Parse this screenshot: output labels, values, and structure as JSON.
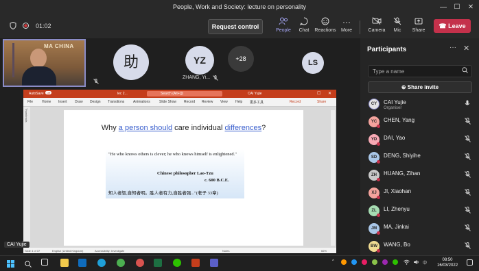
{
  "window": {
    "title": "People, Work and Society: lecture on personality",
    "controls": {
      "minimize": "—",
      "maximize": "☐",
      "close": "✕"
    }
  },
  "toolbar": {
    "timer": "01:02",
    "request_control": "Request control",
    "tools": [
      {
        "label": "People",
        "icon": "people-icon"
      },
      {
        "label": "Chat",
        "icon": "chat-icon"
      },
      {
        "label": "Reactions",
        "icon": "reactions-icon"
      },
      {
        "label": "More",
        "icon": "more-icon"
      },
      {
        "label": "Camera",
        "icon": "camera-off-icon"
      },
      {
        "label": "Mic",
        "icon": "mic-off-icon"
      },
      {
        "label": "Share",
        "icon": "share-icon"
      }
    ],
    "leave": "Leave"
  },
  "stage": {
    "video_brand": "MA CHINA",
    "avatar_zhu": "助",
    "avatar_yz": "YZ",
    "avatar_yz_name": "ZHANG, Yi...",
    "overflow": "+28",
    "avatar_ls": "LS",
    "active_speaker": "CAI Yujie"
  },
  "ppt": {
    "autosave": "AutoSave",
    "autosave_state": "Off",
    "filename": "lec 2...",
    "search": "Search (Alt+Q)",
    "user": "CAI Yujie",
    "menu": [
      "File",
      "Home",
      "Insert",
      "Draw",
      "Design",
      "Transitions",
      "Animations",
      "Slide Show",
      "Record",
      "Review",
      "View",
      "Help",
      "更多工具"
    ],
    "record": "Record",
    "share": "Share",
    "thumbnails": "Thumbnails",
    "status_slide": "Slide 4 of 37",
    "status_lang": "English (United Kingdom)",
    "status_access": "Accessibility: Investigate",
    "status_notes": "Notes",
    "status_zoom": "66%"
  },
  "slide": {
    "title_pre": "Why ",
    "title_u1": "a person should",
    "title_mid": " care individual ",
    "title_u2": "differences",
    "title_post": "?",
    "quote": "\"He who knows others is clever; he who knows himself is enlightened.\"",
    "attrib1": "Chinese philosopher Lao-Tzu",
    "attrib2": "c. 600 B.C.E.",
    "chinese": "知人者智,自知者明。胜人者有力,自胜者强...\"(老子 33章)"
  },
  "panel": {
    "title": "Participants",
    "more": "···",
    "close": "✕",
    "search_placeholder": "Type a name",
    "share_invite": "Share invite",
    "participants": [
      {
        "initials": "CY",
        "name": "CAI Yujie",
        "role": "Organiser",
        "color": "#e3e3e3"
      },
      {
        "initials": "YC",
        "name": "CHEN, Yang",
        "role": "",
        "color": "#f4a39d"
      },
      {
        "initials": "YD",
        "name": "DAI, Yao",
        "role": "",
        "color": "#f7a9b4"
      },
      {
        "initials": "SD",
        "name": "DENG, Shiyihe",
        "role": "",
        "color": "#a9c7e8"
      },
      {
        "initials": "ZH",
        "name": "HUANG, Zihan",
        "role": "",
        "color": "#c9c9c9"
      },
      {
        "initials": "XJ",
        "name": "JI, Xiaohan",
        "role": "",
        "color": "#f4a39d"
      },
      {
        "initials": "ZL",
        "name": "LI, Zhenyu",
        "role": "",
        "color": "#a6dcb2"
      },
      {
        "initials": "JM",
        "name": "MA, Jinkai",
        "role": "",
        "color": "#a9c7e8"
      },
      {
        "initials": "BW",
        "name": "WANG, Bo",
        "role": "",
        "color": "#f1dc92"
      }
    ]
  },
  "taskbar": {
    "time": "08:50",
    "date": "16/03/2022"
  }
}
